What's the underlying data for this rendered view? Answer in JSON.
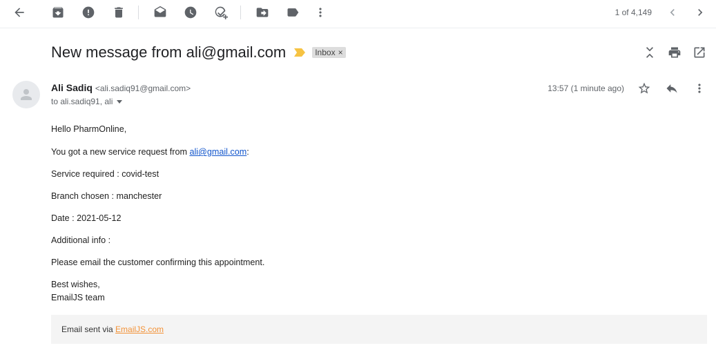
{
  "toolbar": {
    "counter": "1 of 4,149",
    "icons": [
      "back-arrow-icon",
      "archive-icon",
      "report-spam-icon",
      "delete-icon",
      "mark-unread-icon",
      "snooze-icon",
      "add-to-tasks-icon",
      "move-to-icon",
      "label-icon",
      "more-icon",
      "older-icon",
      "newer-icon"
    ]
  },
  "subject": {
    "title": "New message from ali@gmail.com",
    "label": "Inbox",
    "label_remove": "×",
    "importance_color": "#f6c343"
  },
  "message": {
    "sender_name": "Ali Sadiq",
    "sender_email": "<ali.sadiq91@gmail.com>",
    "recipients": "to ali.sadiq91, ali",
    "timestamp": "13:57 (1 minute ago)"
  },
  "body": {
    "greeting": "Hello PharmOnline,",
    "request_prefix": "You got a new service request from ",
    "request_link": "ali@gmail.com",
    "request_suffix": ":",
    "service": "Service required : covid-test",
    "branch": "Branch chosen : manchester",
    "date": "Date : 2021-05-12",
    "additional": "Additional info :",
    "instruction": "Please email the customer confirming this appointment.",
    "signoff": "Best wishes,",
    "team": "EmailJS team"
  },
  "footer": {
    "prefix": "Email sent via ",
    "link": "EmailJS.com",
    "link_color": "#f39237"
  },
  "colors": {
    "icon": "#5f6368",
    "link": "#1155cc"
  }
}
